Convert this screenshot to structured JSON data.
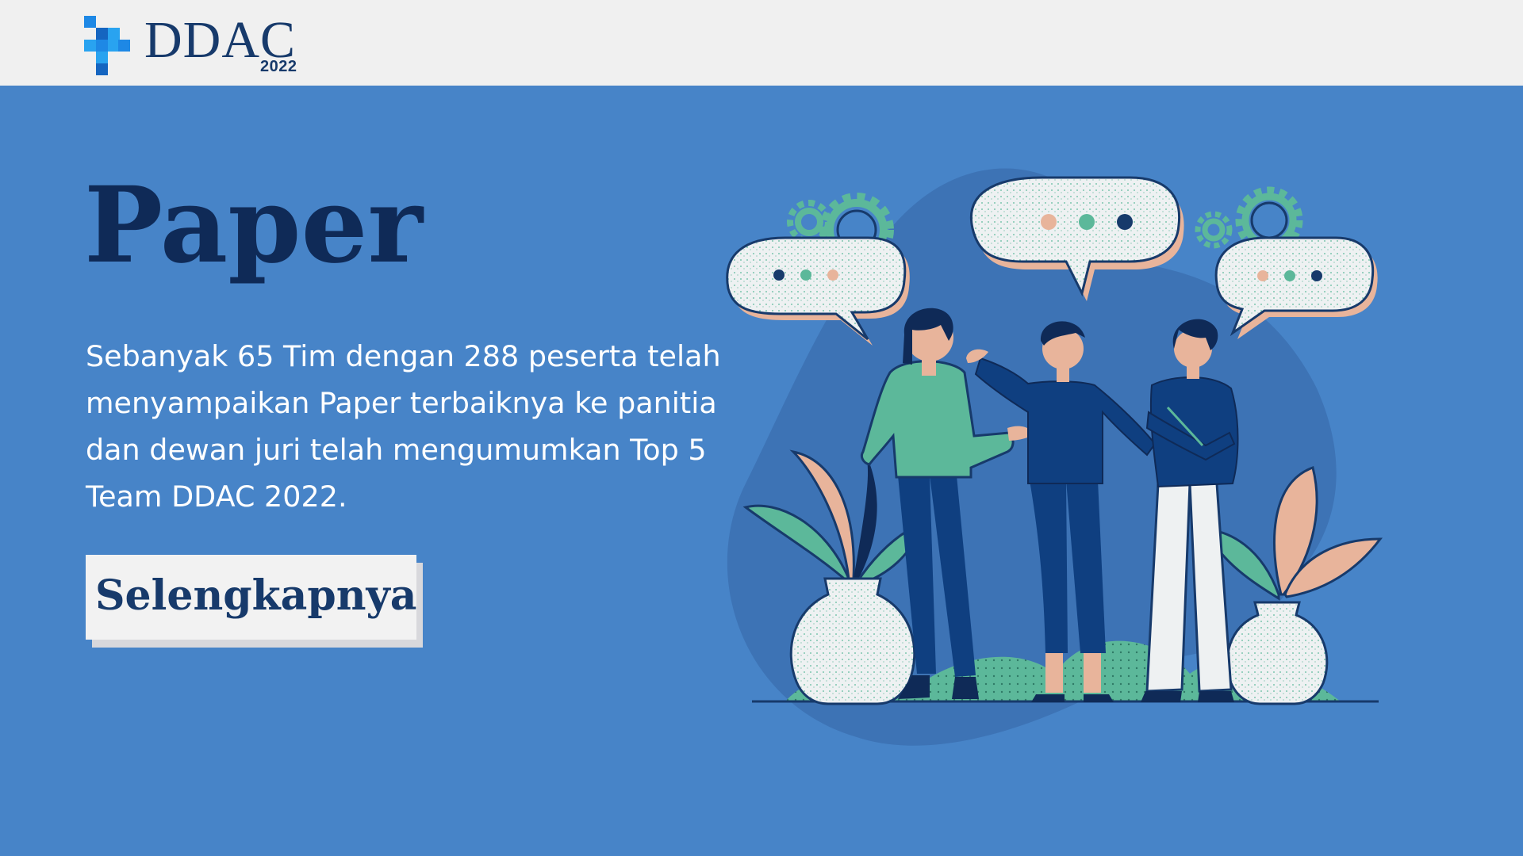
{
  "header": {
    "logo_text": "DDAC",
    "logo_year": "2022"
  },
  "main": {
    "title": "Paper",
    "description": "Sebanyak 65 Tim dengan 288 peserta telah menyampaikan Paper terbaiknya ke panitia dan dewan juri telah mengumumkan Top 5 Team DDAC 2022.",
    "cta_label": "Selengkapnya"
  },
  "colors": {
    "background": "#4784c8",
    "topbar": "#f0f0f0",
    "title": "#0f2a57",
    "brand_navy": "#173a6b",
    "logo_blue": "#1e88e5",
    "accent_green": "#5cb89a",
    "accent_peach": "#e8b49b"
  },
  "icons": {
    "logo_mark": "cross-pixel-logo-icon",
    "illustration": "people-discussion-illustration"
  }
}
